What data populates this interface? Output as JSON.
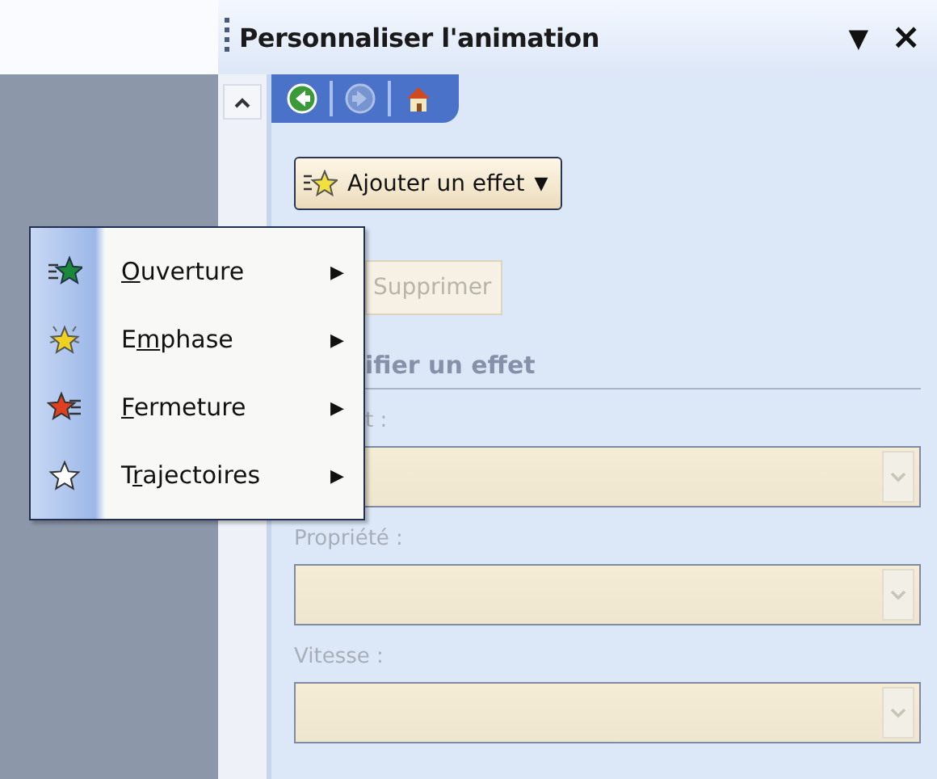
{
  "task_pane": {
    "title": "Personnaliser l'animation",
    "menu_glyph": "▼",
    "close_glyph": "×"
  },
  "nav": [
    {
      "kind": "back",
      "disabled": false
    },
    {
      "kind": "forward",
      "disabled": true
    },
    {
      "kind": "home",
      "disabled": false
    }
  ],
  "add_effect_button": {
    "label": "Ajouter un effet",
    "caret": "▼"
  },
  "remove_button": {
    "label": "Supprimer",
    "disabled": true
  },
  "section_heading": "ifier un effet",
  "covered_field": {
    "label": "t :",
    "disabled": true
  },
  "fields": [
    {
      "label": "Propriété :",
      "disabled": true
    },
    {
      "label": "Vitesse :",
      "disabled": true
    }
  ],
  "menu": {
    "items": [
      {
        "key": "O",
        "after": "uverture",
        "arrow": "▶",
        "color": "#1a8a3a",
        "kind": "entrance"
      },
      {
        "before": "E",
        "key": "m",
        "after": "phase",
        "arrow": "▶",
        "color": "#f0d020",
        "kind": "emphasis"
      },
      {
        "key": "F",
        "after": "ermeture",
        "arrow": "▶",
        "color": "#e04020",
        "kind": "exit"
      },
      {
        "before": "T",
        "key": "r",
        "after": "ajectoires",
        "arrow": "▶",
        "color": "#ffffff",
        "kind": "path"
      }
    ]
  }
}
